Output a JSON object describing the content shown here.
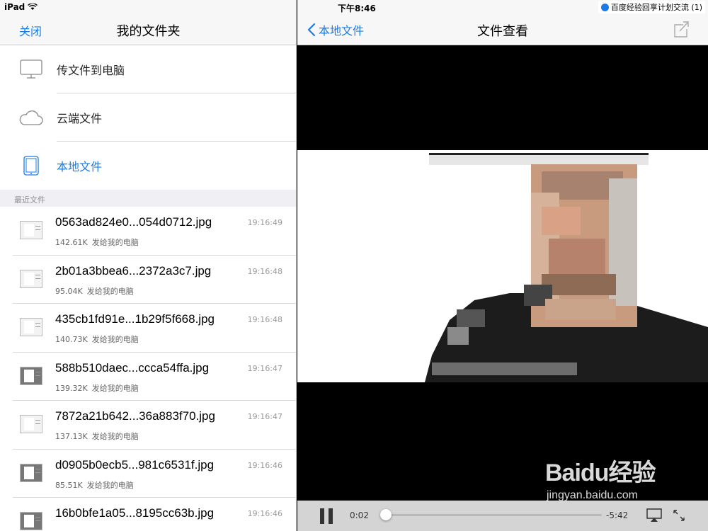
{
  "status_bar": {
    "device": "iPad",
    "time": "下午8:46",
    "notification": "百度经验回享计划交流 (1)"
  },
  "left": {
    "close_label": "关闭",
    "title": "我的文件夹",
    "menu": [
      {
        "label": "传文件到电脑",
        "icon": "monitor-icon"
      },
      {
        "label": "云端文件",
        "icon": "cloud-icon"
      },
      {
        "label": "本地文件",
        "icon": "ipad-icon"
      }
    ],
    "recent_header": "最近文件",
    "files": [
      {
        "name": "0563ad824e0...054d0712.jpg",
        "size": "142.61K",
        "dest": "发给我的电脑",
        "time": "19:16:49"
      },
      {
        "name": "2b01a3bbea6...2372a3c7.jpg",
        "size": "95.04K",
        "dest": "发给我的电脑",
        "time": "19:16:48"
      },
      {
        "name": "435cb1fd91e...1b29f5f668.jpg",
        "size": "140.73K",
        "dest": "发给我的电脑",
        "time": "19:16:48"
      },
      {
        "name": "588b510daec...ccca54ffa.jpg",
        "size": "139.32K",
        "dest": "发给我的电脑",
        "time": "19:16:47"
      },
      {
        "name": "7872a21b642...36a883f70.jpg",
        "size": "137.13K",
        "dest": "发给我的电脑",
        "time": "19:16:47"
      },
      {
        "name": "d0905b0ecb5...981c6531f.jpg",
        "size": "85.51K",
        "dest": "发给我的电脑",
        "time": "19:16:46"
      },
      {
        "name": "16b0bfe1a05...8195cc63b.jpg",
        "size": "",
        "dest": "",
        "time": "19:16:46"
      }
    ]
  },
  "right": {
    "back_label": "本地文件",
    "title": "文件查看",
    "player": {
      "current": "0:02",
      "remaining": "-5:42",
      "progress": 0.01
    },
    "watermark": {
      "logo": "Baidu经验",
      "url": "jingyan.baidu.com"
    }
  }
}
